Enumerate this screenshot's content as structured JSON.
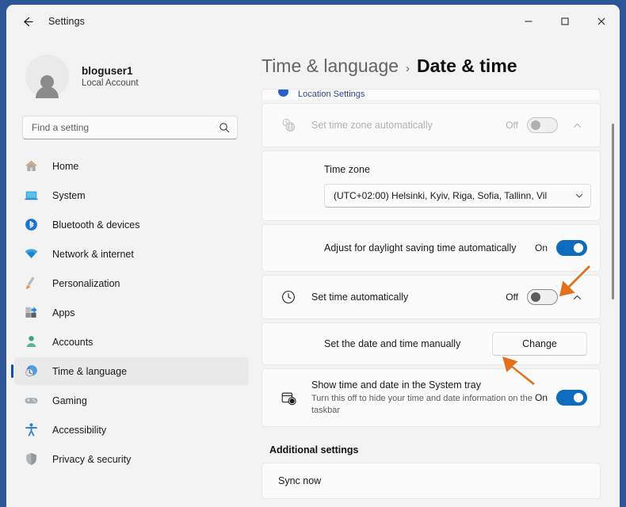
{
  "window": {
    "app_title": "Settings",
    "back_icon": "back-arrow-icon",
    "minimize_label": "─",
    "maximize_label": "□",
    "close_label": "✕"
  },
  "profile": {
    "name": "bloguser1",
    "account_type": "Local Account",
    "avatar_icon": "user-avatar-icon"
  },
  "search": {
    "placeholder": "Find a setting",
    "value": "",
    "icon": "search-icon"
  },
  "sidebar": {
    "items": [
      {
        "label": "Home",
        "icon": "home-icon",
        "selected": false
      },
      {
        "label": "System",
        "icon": "system-icon",
        "selected": false
      },
      {
        "label": "Bluetooth & devices",
        "icon": "bluetooth-icon",
        "selected": false
      },
      {
        "label": "Network & internet",
        "icon": "wifi-icon",
        "selected": false
      },
      {
        "label": "Personalization",
        "icon": "paintbrush-icon",
        "selected": false
      },
      {
        "label": "Apps",
        "icon": "apps-icon",
        "selected": false
      },
      {
        "label": "Accounts",
        "icon": "account-icon",
        "selected": false
      },
      {
        "label": "Time & language",
        "icon": "time-language-icon",
        "selected": true
      },
      {
        "label": "Gaming",
        "icon": "gamepad-icon",
        "selected": false
      },
      {
        "label": "Accessibility",
        "icon": "accessibility-icon",
        "selected": false
      },
      {
        "label": "Privacy & security",
        "icon": "shield-icon",
        "selected": false
      }
    ]
  },
  "breadcrumb": {
    "parent": "Time & language",
    "separator": "›",
    "current": "Date & time"
  },
  "main": {
    "location_settings_link": "Location Settings",
    "set_timezone_auto": {
      "title": "Set time zone automatically",
      "state": "Off",
      "enabled": false,
      "icon": "timezone-globe-icon",
      "expander_icon": "chevron-up-icon"
    },
    "time_zone": {
      "label": "Time zone",
      "selected": "(UTC+02:00) Helsinki, Kyiv, Riga, Sofia, Tallinn, Vil",
      "dropdown_icon": "chevron-down-icon"
    },
    "daylight_saving": {
      "title": "Adjust for daylight saving time automatically",
      "state": "On"
    },
    "set_time_auto": {
      "title": "Set time automatically",
      "state": "Off",
      "icon": "clock-icon",
      "expander_icon": "chevron-up-icon"
    },
    "set_manually": {
      "label": "Set the date and time manually",
      "button": "Change"
    },
    "system_tray": {
      "title": "Show time and date in the System tray",
      "description": "Turn this off to hide your time and date information on the taskbar",
      "state": "On",
      "icon": "calendar-clock-icon"
    },
    "additional_settings_heading": "Additional settings",
    "sync_now": "Sync now"
  },
  "annotations": {
    "arrow_color": "#e2701d",
    "arrow_toggle": "arrow-pointing-to-set-time-toggle",
    "arrow_change": "arrow-pointing-to-change-button"
  },
  "colors": {
    "accent": "#0f6cbd",
    "window_border": "#2d5699",
    "selection_bar": "#0f51a8",
    "link": "#2c4a8a"
  }
}
